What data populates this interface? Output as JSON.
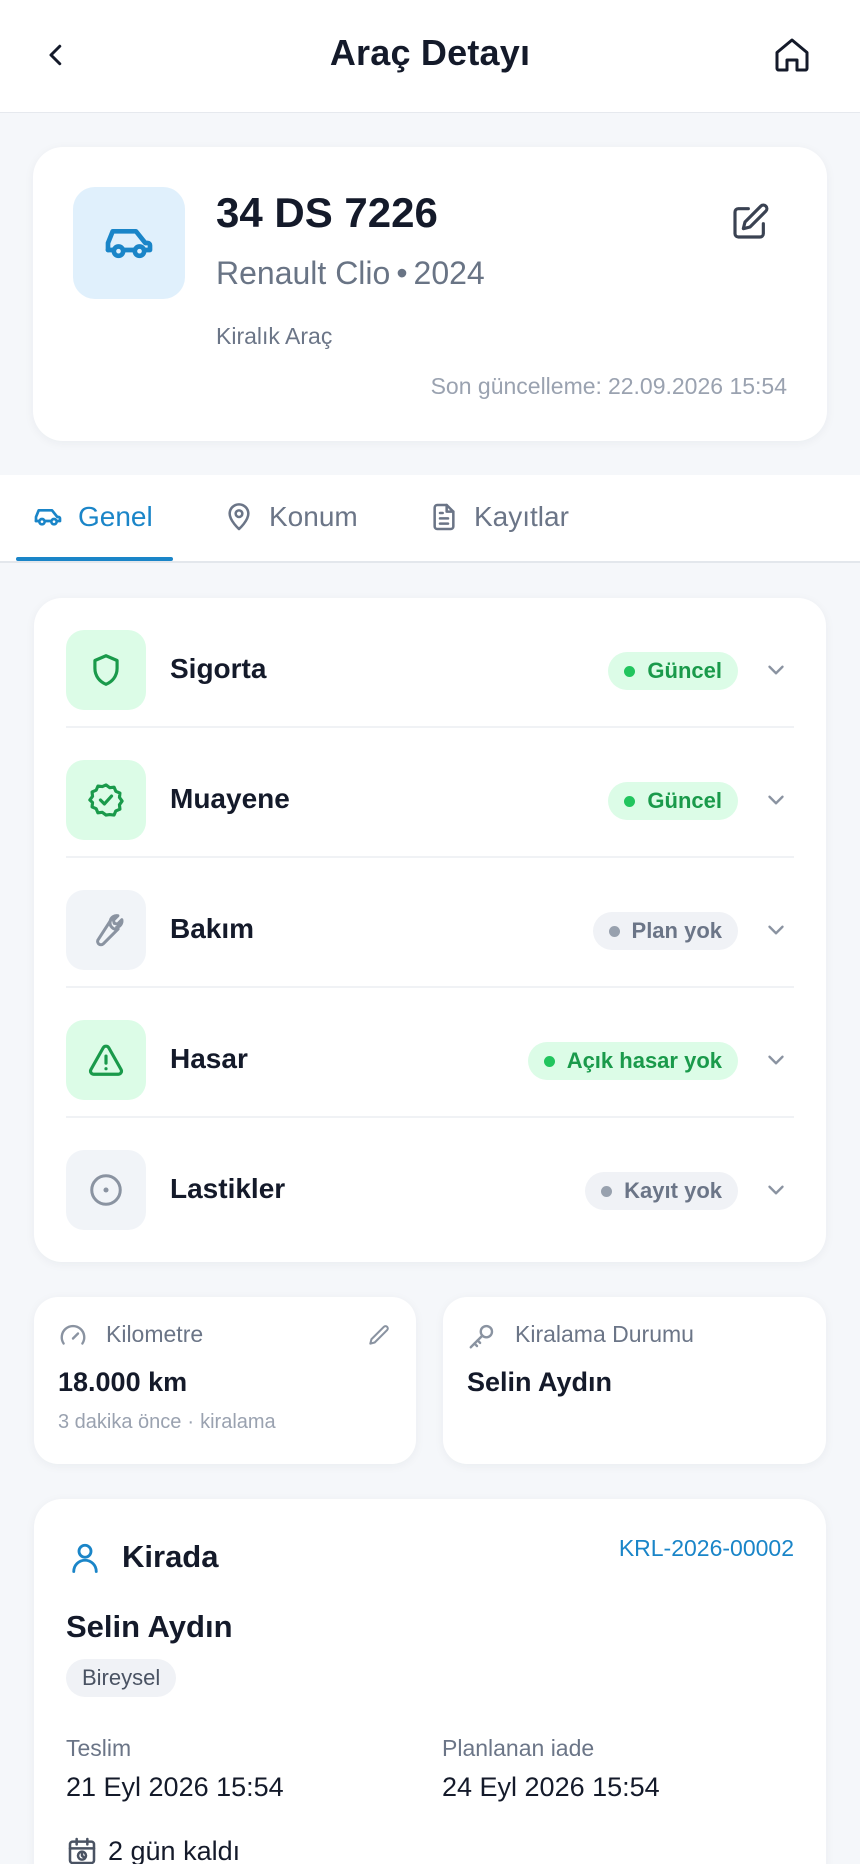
{
  "header": {
    "title": "Araç Detayı",
    "back_icon": "chevron-left-icon",
    "home_icon": "home-icon"
  },
  "vehicle": {
    "plate": "34 DS 7226",
    "make_model": "Renault Clio",
    "separator": "•",
    "year": "2024",
    "type": "Kiralık Araç",
    "updated_label": "Son güncelleme:",
    "updated_value": "22.09.2026 15:54",
    "icon": "car-icon",
    "edit_icon": "edit-icon"
  },
  "tabs": [
    {
      "label": "Genel",
      "icon": "car-icon",
      "active": true
    },
    {
      "label": "Konum",
      "icon": "map-pin-icon",
      "active": false
    },
    {
      "label": "Kayıtlar",
      "icon": "document-icon",
      "active": false
    }
  ],
  "status_items": [
    {
      "title": "Sigorta",
      "badge": "Güncel",
      "badge_color": "green",
      "icon": "shield-icon"
    },
    {
      "title": "Muayene",
      "badge": "Güncel",
      "badge_color": "green",
      "icon": "badge-check-icon"
    },
    {
      "title": "Bakım",
      "badge": "Plan yok",
      "badge_color": "gray",
      "icon": "wrench-icon"
    },
    {
      "title": "Hasar",
      "badge": "Açık hasar yok",
      "badge_color": "green",
      "icon": "warning-icon"
    },
    {
      "title": "Lastikler",
      "badge": "Kayıt yok",
      "badge_color": "gray",
      "icon": "tire-icon"
    }
  ],
  "odometer": {
    "label": "Kilometre",
    "value": "18.000 km",
    "time": "3 dakika önce",
    "dot": "·",
    "source": "kiralama",
    "icon": "gauge-icon",
    "edit_icon": "pencil-icon"
  },
  "rental_status": {
    "label": "Kiralama Durumu",
    "value": "Selin Aydın",
    "icon": "key-icon"
  },
  "rental": {
    "status": "Kirada",
    "code": "KRL-2026-00002",
    "renter_name": "Selin Aydın",
    "renter_type": "Bireysel",
    "delivery_label": "Teslim",
    "delivery_value": "21 Eyl 2026 15:54",
    "return_label": "Planlanan iade",
    "return_value": "24 Eyl 2026 15:54",
    "remaining": "2 gün kaldı",
    "icon": "user-icon",
    "remaining_icon": "calendar-clock-icon"
  },
  "colors": {
    "accent": "#1a85c8",
    "green": "#1a9a4b",
    "green_bg": "#dcfce7",
    "gray_bg": "#f0f2f6",
    "text": "#141a2a",
    "muted": "#6b7587"
  }
}
